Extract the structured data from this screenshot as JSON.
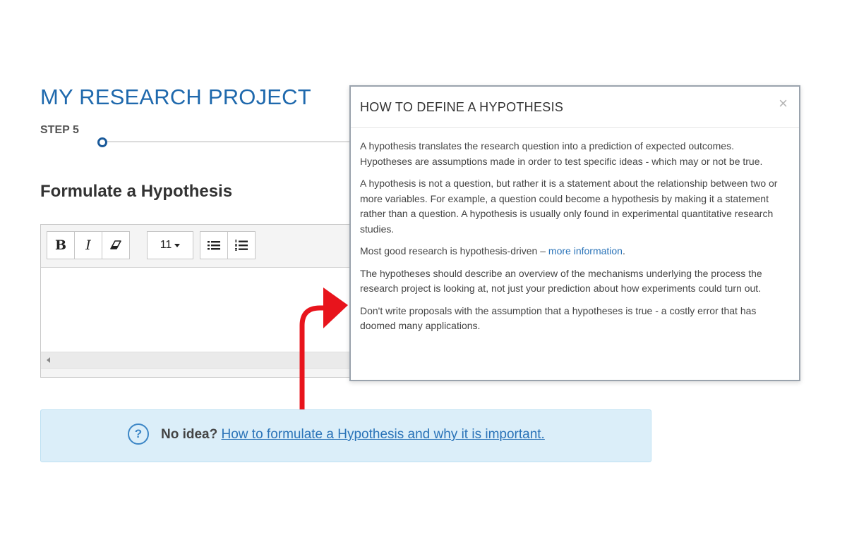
{
  "page": {
    "title": "MY RESEARCH PROJECT",
    "step_label": "STEP 5",
    "section_title": "Formulate a Hypothesis"
  },
  "editor": {
    "toolbar": {
      "bold": "B",
      "italic": "I",
      "font_size": "11"
    },
    "content": ""
  },
  "modal": {
    "title": "HOW TO DEFINE A HYPOTHESIS",
    "close": "×",
    "paragraphs": {
      "p1": "A hypothesis translates the research question into a prediction of expected outcomes. Hypotheses are assumptions made in order to test specific ideas - which may or not be true.",
      "p2": "A hypothesis is not a question, but rather it is a statement about the relationship between two or more variables. For example, a question could become a hypothesis by making it a statement rather than a question. A hypothesis is usually only found in experimental quantitative research studies.",
      "p3_text": "Most good research is hypothesis-driven – ",
      "p3_link": "more information",
      "p3_end": ".",
      "p4": "The hypotheses should describe an overview of the mechanisms underlying the process the research project is looking at, not just your prediction about how experiments could turn out.",
      "p5": "Don't write proposals with the assumption that a hypotheses is true - a costly error that has doomed many applications."
    }
  },
  "help": {
    "icon": "?",
    "strong": "No idea?",
    "link": "How to formulate a Hypothesis and why it is important."
  },
  "colors": {
    "title_blue": "#1f69ad",
    "link_blue": "#2a73b8",
    "arrow_red": "#e8141c",
    "help_bg": "#dbeef9"
  }
}
